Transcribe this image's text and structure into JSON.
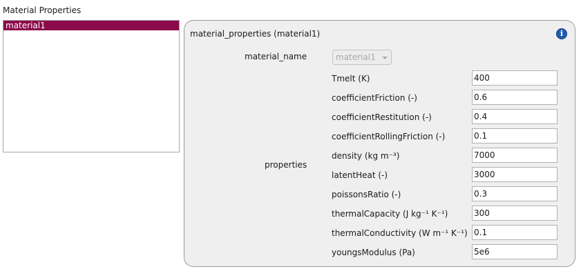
{
  "section": {
    "title": "Material Properties"
  },
  "materials": {
    "items": [
      {
        "label": "material1",
        "selected": true
      }
    ]
  },
  "panel": {
    "title": "material_properties (material1)",
    "info_icon": "info-icon",
    "material_name_label": "material_name",
    "material_name_value": "material1",
    "properties_label": "properties",
    "properties": [
      {
        "label": "Tmelt (K)",
        "value": "400"
      },
      {
        "label": "coefficientFriction (-)",
        "value": "0.6"
      },
      {
        "label": "coefficientRestitution (-)",
        "value": "0.4"
      },
      {
        "label": "coefficientRollingFriction (-)",
        "value": "0.1"
      },
      {
        "label": "density (kg m⁻³)",
        "value": "7000"
      },
      {
        "label": "latentHeat (-)",
        "value": "3000"
      },
      {
        "label": "poissonsRatio (-)",
        "value": "0.3"
      },
      {
        "label": "thermalCapacity (J kg⁻¹ K⁻¹)",
        "value": "300"
      },
      {
        "label": "thermalConductivity (W m⁻¹ K⁻¹)",
        "value": "0.1"
      },
      {
        "label": "youngsModulus (Pa)",
        "value": "5e6"
      }
    ]
  },
  "colors": {
    "selection": "#8b0a4a",
    "info": "#1f5fb0"
  }
}
